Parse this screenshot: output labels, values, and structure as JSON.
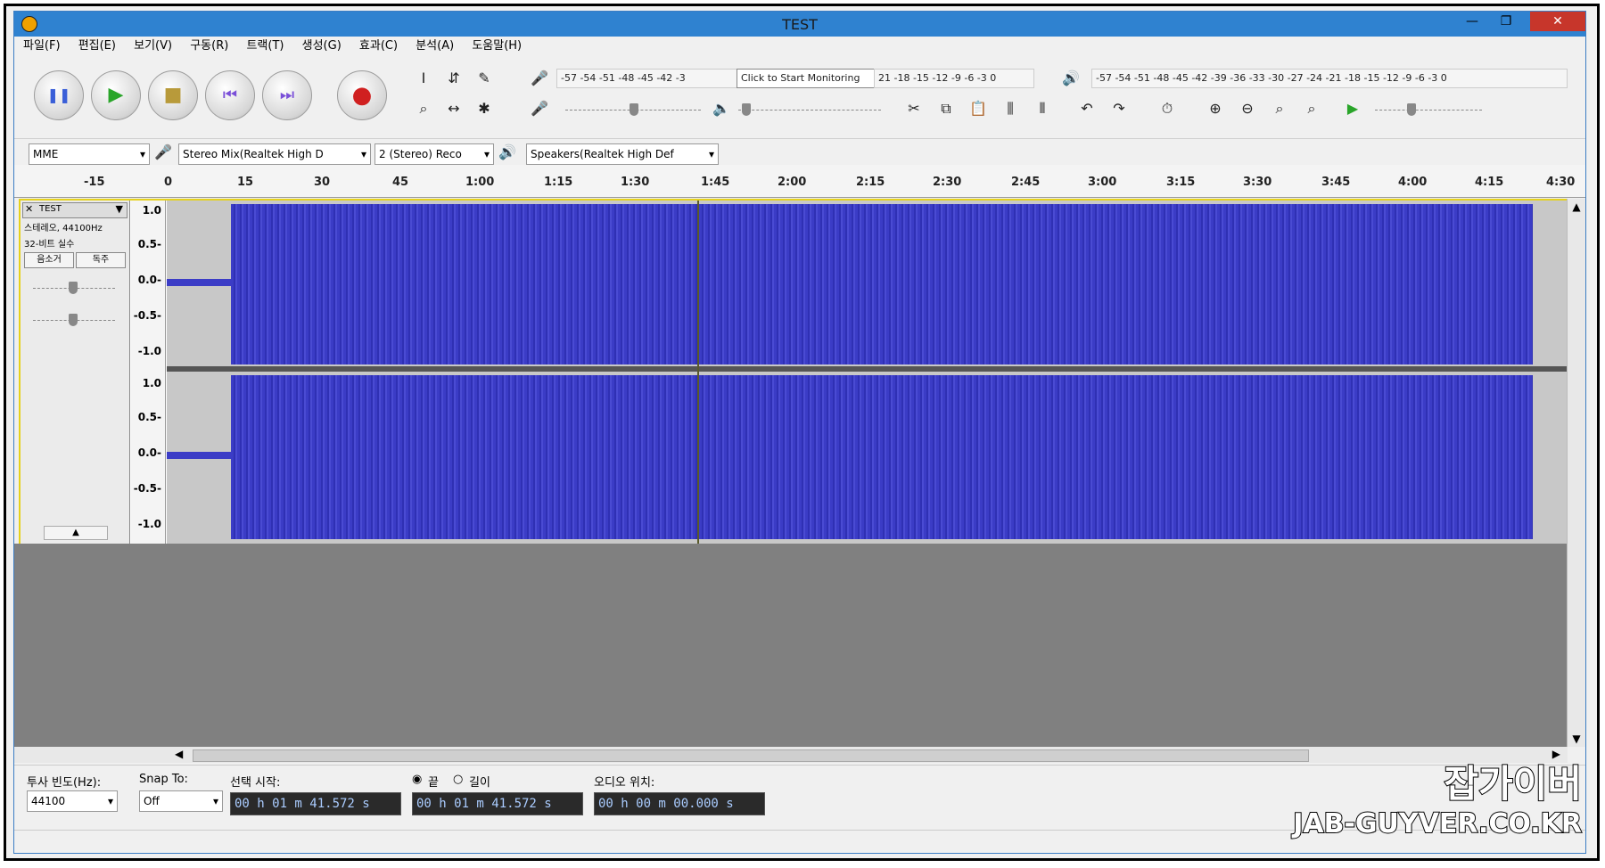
{
  "window": {
    "title": "TEST"
  },
  "menu": [
    "파일(F)",
    "편집(E)",
    "보기(V)",
    "구동(R)",
    "트랙(T)",
    "생성(G)",
    "효과(C)",
    "분석(A)",
    "도움말(H)"
  ],
  "transport": {
    "pause": "❚❚",
    "play": "▶",
    "stop": "■",
    "skip_start": "⏮",
    "skip_end": "⏭",
    "record": "●"
  },
  "meters": {
    "record_scale": "-57 -54 -51 -48 -45 -42 -3",
    "monitor_hint": "Click to Start Monitoring",
    "record_scale_right": "21 -18 -15 -12 -9 -6 -3 0",
    "play_scale": "-57 -54 -51 -48 -45 -42 -39 -36 -33 -30 -27 -24 -21 -18 -15 -12 -9 -6 -3 0"
  },
  "devices": {
    "host": "MME",
    "input": "Stereo Mix(Realtek High D",
    "channels": "2 (Stereo) Reco",
    "output": "Speakers(Realtek High Def"
  },
  "ruler_labels": [
    "-15",
    "0",
    "15",
    "30",
    "45",
    "1:00",
    "1:15",
    "1:30",
    "1:45",
    "2:00",
    "2:15",
    "2:30",
    "2:45",
    "3:00",
    "3:15",
    "3:30",
    "3:45",
    "4:00",
    "4:15",
    "4:30"
  ],
  "track": {
    "name": "TEST",
    "info1": "스테레오, 44100Hz",
    "info2": "32-비트 실수",
    "mute": "음소거",
    "solo": "독주",
    "scale_top": [
      "1.0",
      "0.5-",
      "0.0-",
      "-0.5-",
      "-1.0"
    ],
    "scale_bottom": [
      "1.0",
      "0.5-",
      "0.0-",
      "-0.5-",
      "-1.0"
    ]
  },
  "selection": {
    "rate_label": "투사 빈도(Hz):",
    "rate_value": "44100",
    "snap_label": "Snap To:",
    "snap_value": "Off",
    "start_label": "선택 시작:",
    "end_label": "끝",
    "length_label": "길이",
    "audio_pos_label": "오디오 위치:",
    "start_time": "00 h 01 m 41.572 s",
    "end_time": "00 h 01 m 41.572 s",
    "audio_pos": "00 h 00 m 00.000 s"
  },
  "watermark": {
    "line1": "잡가이버",
    "line2": "JAB-GUYVER.CO.KR"
  }
}
